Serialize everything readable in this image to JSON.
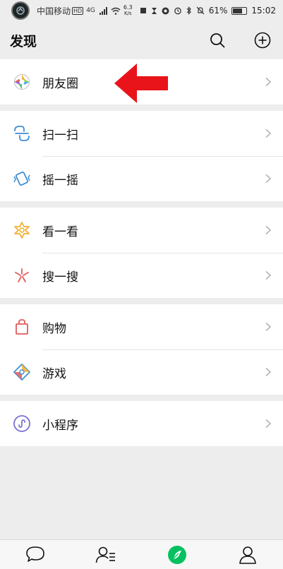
{
  "status_bar": {
    "carrier": "中国移动",
    "hd": "HD",
    "network_type": "4G",
    "speed_value": "6.3",
    "speed_unit": "K/s",
    "battery_percent": "61%",
    "battery_level": 0.61,
    "time": "15:02"
  },
  "header": {
    "title": "发现"
  },
  "groups": [
    {
      "items": [
        {
          "label": "朋友圈",
          "icon": "moments-icon"
        }
      ]
    },
    {
      "items": [
        {
          "label": "扫一扫",
          "icon": "scan-icon"
        },
        {
          "label": "摇一摇",
          "icon": "shake-icon"
        }
      ]
    },
    {
      "items": [
        {
          "label": "看一看",
          "icon": "top-stories-icon"
        },
        {
          "label": "搜一搜",
          "icon": "search-discover-icon"
        }
      ]
    },
    {
      "items": [
        {
          "label": "购物",
          "icon": "shopping-bag-icon"
        },
        {
          "label": "游戏",
          "icon": "games-icon"
        }
      ]
    },
    {
      "items": [
        {
          "label": "小程序",
          "icon": "mini-programs-icon"
        }
      ]
    }
  ],
  "tabbar": {
    "tabs": [
      {
        "name": "chats",
        "icon": "chat-bubble-icon"
      },
      {
        "name": "contacts",
        "icon": "contacts-icon"
      },
      {
        "name": "discover",
        "icon": "compass-icon",
        "active": true
      },
      {
        "name": "me",
        "icon": "person-icon"
      }
    ]
  },
  "colors": {
    "background": "#ededed",
    "active_green": "#07c160",
    "annotation_arrow": "#e8141a"
  }
}
